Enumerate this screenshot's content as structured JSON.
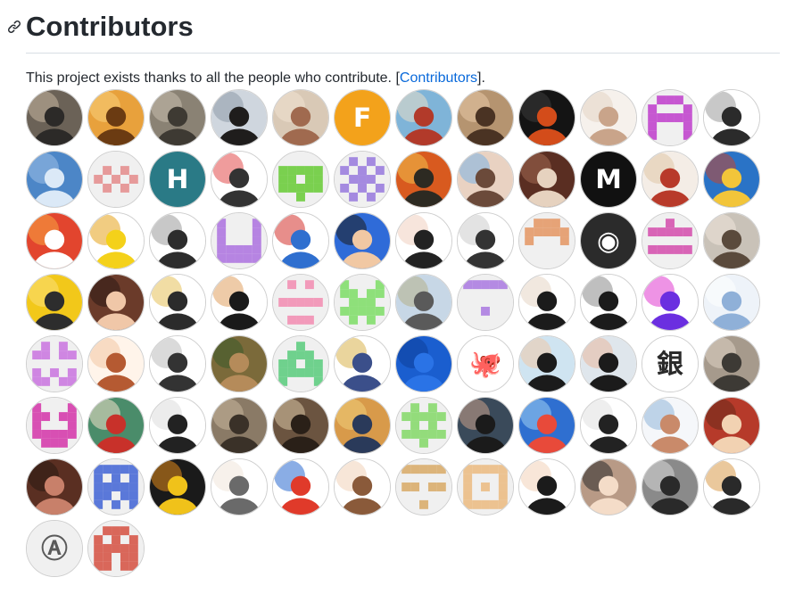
{
  "heading": {
    "title": "Contributors"
  },
  "intro": {
    "text": "This project exists thanks to all the people who contribute. [",
    "link": "Contributors",
    "suffix": "]."
  },
  "avatars": [
    {
      "kind": "photo",
      "bg": "#6b6257",
      "fg": "#2c2a28",
      "alt": "#c7b6a0"
    },
    {
      "kind": "photo",
      "bg": "#e8a13c",
      "fg": "#6b3b12",
      "alt": "#f7d27b"
    },
    {
      "kind": "photo",
      "bg": "#8a8274",
      "fg": "#3e3a33",
      "alt": "#c9bfae"
    },
    {
      "kind": "photo",
      "bg": "#cfd6de",
      "fg": "#1f1d1c",
      "alt": "#8e9aa8"
    },
    {
      "kind": "photo",
      "bg": "#d9c9b6",
      "fg": "#a06a4f",
      "alt": "#f1e2d2"
    },
    {
      "kind": "letter",
      "bg": "#f3a21b",
      "fg": "#ffffff",
      "letter": "F"
    },
    {
      "kind": "photo",
      "bg": "#7fb4d8",
      "fg": "#b23a2a",
      "alt": "#e9dfc8"
    },
    {
      "kind": "photo",
      "bg": "#b59470",
      "fg": "#4a3323",
      "alt": "#e7c9a7"
    },
    {
      "kind": "photo",
      "bg": "#141414",
      "fg": "#d34c1a",
      "alt": "#3b3b3b"
    },
    {
      "kind": "photo",
      "bg": "#f6f1ec",
      "fg": "#c9a48a",
      "alt": "#e4d3c4"
    },
    {
      "kind": "identicon",
      "bg": "#f0f0f0",
      "fg": "#c657d1",
      "pattern": [
        0,
        1,
        1,
        1,
        0,
        1,
        0,
        0,
        0,
        1,
        1,
        1,
        1,
        1,
        1,
        1,
        0,
        0,
        0,
        1,
        1,
        0,
        0,
        0,
        1
      ]
    },
    {
      "kind": "photo",
      "bg": "#ffffff",
      "fg": "#2b2b2b",
      "alt": "#9a9a9a"
    },
    {
      "kind": "photo",
      "bg": "#4c86c7",
      "fg": "#dbe9f7",
      "alt": "#9dc0e6"
    },
    {
      "kind": "identicon",
      "bg": "#f0f0f0",
      "fg": "#e69a9a",
      "pattern": [
        0,
        0,
        0,
        0,
        0,
        0,
        1,
        0,
        1,
        0,
        1,
        0,
        1,
        0,
        1,
        0,
        1,
        0,
        1,
        0,
        0,
        0,
        0,
        0,
        0
      ]
    },
    {
      "kind": "letter",
      "bg": "#2a7a86",
      "fg": "#ffffff",
      "letter": "H"
    },
    {
      "kind": "photo",
      "bg": "#ffffff",
      "fg": "#333333",
      "alt": "#e24b4b"
    },
    {
      "kind": "identicon",
      "bg": "#f0f0f0",
      "fg": "#7ad04f",
      "pattern": [
        0,
        0,
        0,
        0,
        0,
        1,
        1,
        1,
        1,
        1,
        1,
        1,
        0,
        1,
        1,
        1,
        1,
        1,
        1,
        1,
        0,
        0,
        1,
        0,
        0
      ]
    },
    {
      "kind": "identicon",
      "bg": "#f0f0f0",
      "fg": "#a48ae0",
      "pattern": [
        0,
        1,
        0,
        1,
        0,
        1,
        0,
        1,
        0,
        1,
        0,
        1,
        1,
        1,
        0,
        1,
        0,
        1,
        0,
        1,
        0,
        1,
        0,
        1,
        0
      ]
    },
    {
      "kind": "photo",
      "bg": "#d85a1f",
      "fg": "#2d2a22",
      "alt": "#f2c14a"
    },
    {
      "kind": "photo",
      "bg": "#e9d2c2",
      "fg": "#6b4a3a",
      "alt": "#7bb3e6"
    },
    {
      "kind": "photo",
      "bg": "#5a2e22",
      "fg": "#e6d2bf",
      "alt": "#a36a52"
    },
    {
      "kind": "letter",
      "bg": "#111111",
      "fg": "#ffffff",
      "letter": "M"
    },
    {
      "kind": "photo",
      "bg": "#f4ede6",
      "fg": "#b83a2a",
      "alt": "#e0c6a6"
    },
    {
      "kind": "photo",
      "bg": "#2a73c6",
      "fg": "#f2c53a",
      "alt": "#c2452f"
    },
    {
      "kind": "photo",
      "bg": "#e2452e",
      "fg": "#ffffff",
      "alt": "#f7a642"
    },
    {
      "kind": "photo",
      "bg": "#ffffff",
      "fg": "#f4d11a",
      "alt": "#e5a21a"
    },
    {
      "kind": "photo",
      "bg": "#ffffff",
      "fg": "#2d2d2d",
      "alt": "#9a9a9a"
    },
    {
      "kind": "identicon",
      "bg": "#f0f0f0",
      "fg": "#b684e2",
      "pattern": [
        1,
        0,
        0,
        0,
        1,
        1,
        0,
        0,
        0,
        1,
        1,
        0,
        0,
        0,
        1,
        1,
        1,
        1,
        1,
        1,
        1,
        1,
        1,
        1,
        1
      ]
    },
    {
      "kind": "photo",
      "bg": "#ffffff",
      "fg": "#2f6fcf",
      "alt": "#d4322c"
    },
    {
      "kind": "photo",
      "bg": "#2f6bd8",
      "fg": "#f1c8a3",
      "alt": "#1b1b1b"
    },
    {
      "kind": "photo",
      "bg": "#ffffff",
      "fg": "#222222",
      "alt": "#f0d0c0"
    },
    {
      "kind": "photo",
      "bg": "#ffffff",
      "fg": "#333333",
      "alt": "#cccccc"
    },
    {
      "kind": "identicon",
      "bg": "#f0f0f0",
      "fg": "#e6a377",
      "pattern": [
        0,
        1,
        1,
        1,
        0,
        1,
        1,
        1,
        1,
        1,
        1,
        0,
        0,
        0,
        1,
        0,
        0,
        0,
        0,
        0,
        0,
        0,
        0,
        0,
        0
      ]
    },
    {
      "kind": "letter",
      "bg": "#2b2b2b",
      "fg": "#ffffff",
      "letter": "◉"
    },
    {
      "kind": "identicon",
      "bg": "#f0f0f0",
      "fg": "#d864b6",
      "pattern": [
        0,
        0,
        1,
        0,
        0,
        1,
        1,
        1,
        1,
        1,
        0,
        0,
        0,
        0,
        0,
        1,
        1,
        1,
        1,
        1,
        0,
        0,
        0,
        0,
        0
      ]
    },
    {
      "kind": "photo",
      "bg": "#c9c2b8",
      "fg": "#5a4a3c",
      "alt": "#efe6da"
    },
    {
      "kind": "photo",
      "bg": "#f2c81a",
      "fg": "#2d2d2d",
      "alt": "#fbe07a"
    },
    {
      "kind": "photo",
      "bg": "#6b3b2a",
      "fg": "#f0c7a8",
      "alt": "#2b1a14"
    },
    {
      "kind": "photo",
      "bg": "#ffffff",
      "fg": "#2b2b2b",
      "alt": "#e5c15a"
    },
    {
      "kind": "photo",
      "bg": "#ffffff",
      "fg": "#1a1a1a",
      "alt": "#e0a060"
    },
    {
      "kind": "identicon",
      "bg": "#f0f0f0",
      "fg": "#f29aba",
      "pattern": [
        0,
        1,
        0,
        1,
        0,
        0,
        0,
        0,
        0,
        0,
        1,
        1,
        1,
        1,
        1,
        0,
        0,
        0,
        0,
        0,
        0,
        1,
        1,
        1,
        0
      ]
    },
    {
      "kind": "identicon",
      "bg": "#f0f0f0",
      "fg": "#8ee07a",
      "pattern": [
        1,
        0,
        0,
        0,
        1,
        1,
        1,
        0,
        1,
        1,
        0,
        1,
        1,
        1,
        0,
        1,
        1,
        1,
        1,
        1,
        0,
        1,
        0,
        1,
        0
      ]
    },
    {
      "kind": "photo",
      "bg": "#c7d7e6",
      "fg": "#5a5a5a",
      "alt": "#b5b08a"
    },
    {
      "kind": "identicon",
      "bg": "#f0f0f0",
      "fg": "#b48ae3",
      "pattern": [
        1,
        1,
        1,
        1,
        1,
        0,
        0,
        0,
        0,
        0,
        0,
        0,
        0,
        0,
        0,
        0,
        0,
        1,
        0,
        0,
        0,
        0,
        0,
        0,
        0
      ]
    },
    {
      "kind": "photo",
      "bg": "#ffffff",
      "fg": "#1b1b1b",
      "alt": "#e6d5c5"
    },
    {
      "kind": "photo",
      "bg": "#ffffff",
      "fg": "#1b1b1b",
      "alt": "#8a8a8a"
    },
    {
      "kind": "photo",
      "bg": "#ffffff",
      "fg": "#6b2fe0",
      "alt": "#e03ad0"
    },
    {
      "kind": "photo",
      "bg": "#eef3f9",
      "fg": "#8fb0d8",
      "alt": "#ffffff"
    },
    {
      "kind": "identicon",
      "bg": "#f0f0f0",
      "fg": "#cf86e2",
      "pattern": [
        0,
        1,
        0,
        1,
        0,
        1,
        1,
        0,
        1,
        1,
        0,
        0,
        0,
        0,
        0,
        1,
        0,
        1,
        0,
        1,
        1,
        1,
        0,
        1,
        1
      ]
    },
    {
      "kind": "photo",
      "bg": "#fff4ea",
      "fg": "#b55a32",
      "alt": "#f2c7a3"
    },
    {
      "kind": "photo",
      "bg": "#ffffff",
      "fg": "#333333",
      "alt": "#bbbbbb"
    },
    {
      "kind": "photo",
      "bg": "#7b6a3a",
      "fg": "#b58b5a",
      "alt": "#3a5a2a"
    },
    {
      "kind": "identicon",
      "bg": "#f0f0f0",
      "fg": "#6fd18d",
      "pattern": [
        0,
        0,
        1,
        0,
        0,
        0,
        1,
        1,
        1,
        0,
        1,
        1,
        0,
        1,
        1,
        1,
        1,
        1,
        1,
        1,
        1,
        0,
        0,
        0,
        1
      ]
    },
    {
      "kind": "photo",
      "bg": "#ffffff",
      "fg": "#3b4f8a",
      "alt": "#d9b24c"
    },
    {
      "kind": "photo",
      "bg": "#1a5ecf",
      "fg": "#2a73e6",
      "alt": "#0f3f9a"
    },
    {
      "kind": "letter",
      "bg": "#ffffff",
      "fg": "#111111",
      "letter": "🐙"
    },
    {
      "kind": "photo",
      "bg": "#cfe4f1",
      "fg": "#1b1b1b",
      "alt": "#f0c8a8"
    },
    {
      "kind": "photo",
      "bg": "#dfe6ec",
      "fg": "#1b1b1b",
      "alt": "#e8b8a0"
    },
    {
      "kind": "letter",
      "bg": "#ffffff",
      "fg": "#2a2a2a",
      "letter": "銀"
    },
    {
      "kind": "photo",
      "bg": "#a69a8c",
      "fg": "#3d3a35",
      "alt": "#ded3c4"
    },
    {
      "kind": "identicon",
      "bg": "#f0f0f0",
      "fg": "#d84fb3",
      "pattern": [
        1,
        0,
        0,
        0,
        1,
        1,
        1,
        0,
        1,
        1,
        1,
        0,
        0,
        0,
        1,
        1,
        1,
        1,
        1,
        1,
        0,
        1,
        1,
        1,
        0
      ]
    },
    {
      "kind": "photo",
      "bg": "#4a8c6a",
      "fg": "#c8312a",
      "alt": "#f2e2c8"
    },
    {
      "kind": "photo",
      "bg": "#ffffff",
      "fg": "#222222",
      "alt": "#dddddd"
    },
    {
      "kind": "photo",
      "bg": "#8a7a66",
      "fg": "#3a3128",
      "alt": "#c9b69c"
    },
    {
      "kind": "photo",
      "bg": "#6b5440",
      "fg": "#2a2018",
      "alt": "#d9c4a4"
    },
    {
      "kind": "photo",
      "bg": "#d89a4a",
      "fg": "#2a3a5a",
      "alt": "#f0d07a"
    },
    {
      "kind": "identicon",
      "bg": "#f0f0f0",
      "fg": "#93dc7b",
      "pattern": [
        0,
        1,
        0,
        1,
        0,
        1,
        1,
        1,
        1,
        1,
        0,
        1,
        0,
        1,
        0,
        1,
        1,
        1,
        1,
        1,
        0,
        0,
        1,
        0,
        0
      ]
    },
    {
      "kind": "photo",
      "bg": "#3a4a5a",
      "fg": "#1b1b1b",
      "alt": "#c8a08a"
    },
    {
      "kind": "photo",
      "bg": "#2f6fd0",
      "fg": "#e84a3a",
      "alt": "#9fd0f2"
    },
    {
      "kind": "photo",
      "bg": "#ffffff",
      "fg": "#222222",
      "alt": "#e0e0e0"
    },
    {
      "kind": "photo",
      "bg": "#f5f7fa",
      "fg": "#c98a6a",
      "alt": "#8fb7d9"
    },
    {
      "kind": "photo",
      "bg": "#b63a2a",
      "fg": "#f2d2b2",
      "alt": "#6a2a1a"
    },
    {
      "kind": "photo",
      "bg": "#5a2f22",
      "fg": "#c8806a",
      "alt": "#2a1a12"
    },
    {
      "kind": "identicon",
      "bg": "#f0f0f0",
      "fg": "#5a78d9",
      "pattern": [
        1,
        1,
        1,
        1,
        1,
        1,
        0,
        1,
        0,
        1,
        1,
        1,
        1,
        1,
        1,
        1,
        1,
        0,
        1,
        1,
        1,
        0,
        1,
        0,
        1
      ]
    },
    {
      "kind": "photo",
      "bg": "#1a1a1a",
      "fg": "#f0c21a",
      "alt": "#e28a1a"
    },
    {
      "kind": "photo",
      "bg": "#ffffff",
      "fg": "#6a6a6a",
      "alt": "#f0e6da"
    },
    {
      "kind": "photo",
      "bg": "#ffffff",
      "fg": "#e03a2a",
      "alt": "#2a6ad0"
    },
    {
      "kind": "photo",
      "bg": "#ffffff",
      "fg": "#8a5a3a",
      "alt": "#f0d2b8"
    },
    {
      "kind": "identicon",
      "bg": "#f0f0f0",
      "fg": "#dcb47a",
      "pattern": [
        1,
        1,
        1,
        1,
        1,
        0,
        0,
        0,
        0,
        0,
        1,
        1,
        0,
        1,
        1,
        0,
        0,
        0,
        0,
        0,
        0,
        0,
        1,
        0,
        0
      ]
    },
    {
      "kind": "identicon",
      "bg": "#f0f0f0",
      "fg": "#ecc290",
      "pattern": [
        1,
        1,
        1,
        1,
        1,
        1,
        0,
        0,
        0,
        1,
        1,
        0,
        1,
        0,
        1,
        1,
        0,
        0,
        0,
        1,
        1,
        1,
        1,
        1,
        1
      ]
    },
    {
      "kind": "photo",
      "bg": "#ffffff",
      "fg": "#1b1b1b",
      "alt": "#f2d2b8"
    },
    {
      "kind": "photo",
      "bg": "#b89a86",
      "fg": "#f4dcc8",
      "alt": "#2a2a2a"
    },
    {
      "kind": "photo",
      "bg": "#8a8a8a",
      "fg": "#2a2a2a",
      "alt": "#d8d8d8"
    },
    {
      "kind": "photo",
      "bg": "#ffffff",
      "fg": "#2a2a2a",
      "alt": "#d89a4a"
    },
    {
      "kind": "letter",
      "bg": "#f0f0f0",
      "fg": "#5a5a5a",
      "letter": "Ⓐ"
    },
    {
      "kind": "identicon",
      "bg": "#f0f0f0",
      "fg": "#d9675a",
      "pattern": [
        0,
        1,
        1,
        1,
        0,
        1,
        0,
        1,
        0,
        1,
        1,
        1,
        1,
        1,
        1,
        1,
        1,
        0,
        1,
        1,
        1,
        1,
        0,
        1,
        1
      ]
    }
  ]
}
